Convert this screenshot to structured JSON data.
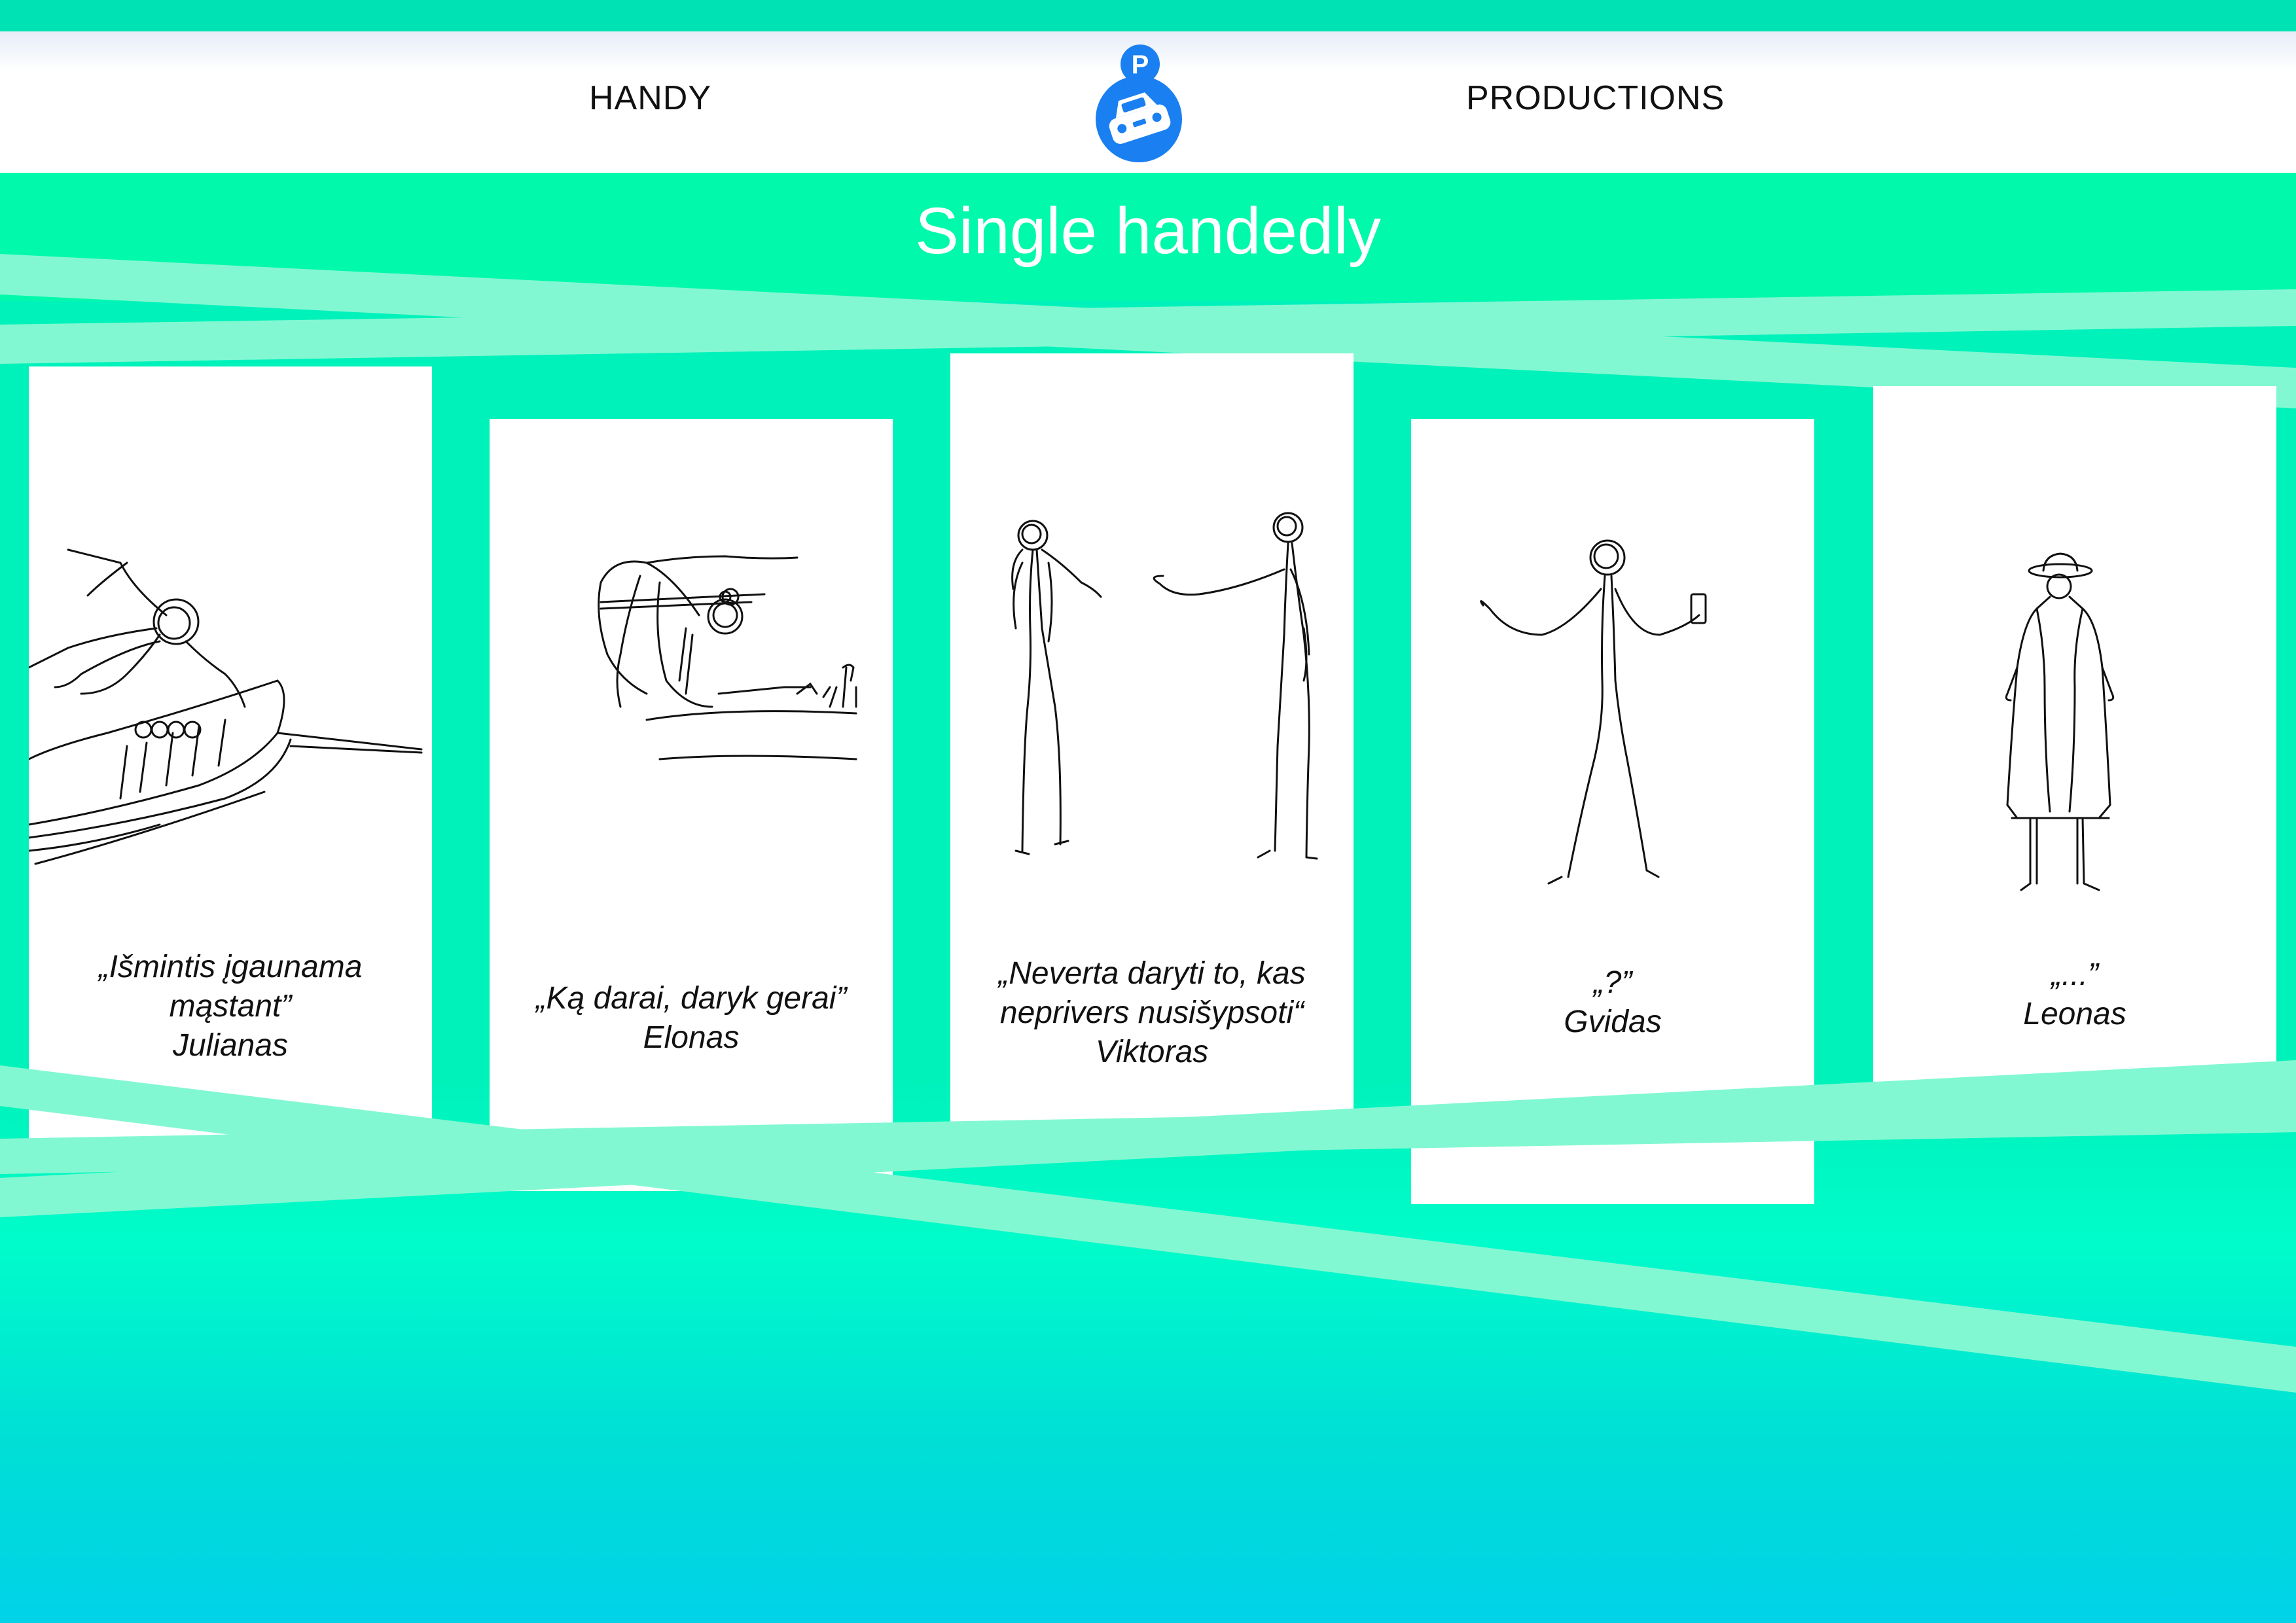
{
  "header": {
    "left_label": "HANDY",
    "right_label": "PRODUCTIONS",
    "logo_icon": "parking-car-logo-icon",
    "logo_letter": "P"
  },
  "banner": {
    "title": "Single handedly"
  },
  "colors": {
    "accent": "#00f9ab",
    "stripe": "#82f8d2",
    "logo": "#1a7ff0",
    "bottom": "#00d2e8"
  },
  "cards": [
    {
      "illustration_icon": "person-leaning-on-car-sketch-icon",
      "quote_lines": [
        "„Išmintis įgaunama",
        "mąstant”"
      ],
      "author": "Julianas"
    },
    {
      "illustration_icon": "person-driving-sketch-icon",
      "quote_lines": [
        "„Ką darai, daryk gerai”"
      ],
      "author": "Elonas"
    },
    {
      "illustration_icon": "two-figures-pointing-sketch-icon",
      "quote_lines": [
        "„Neverta daryti to, kas",
        "neprivers nusišypsoti“"
      ],
      "author": "Viktoras"
    },
    {
      "illustration_icon": "figure-shrugging-with-phone-sketch-icon",
      "quote_lines": [
        "„?”"
      ],
      "author": "Gvidas"
    },
    {
      "illustration_icon": "figure-in-trenchcoat-hat-sketch-icon",
      "quote_lines": [
        "„...”"
      ],
      "author": "Leonas"
    }
  ]
}
